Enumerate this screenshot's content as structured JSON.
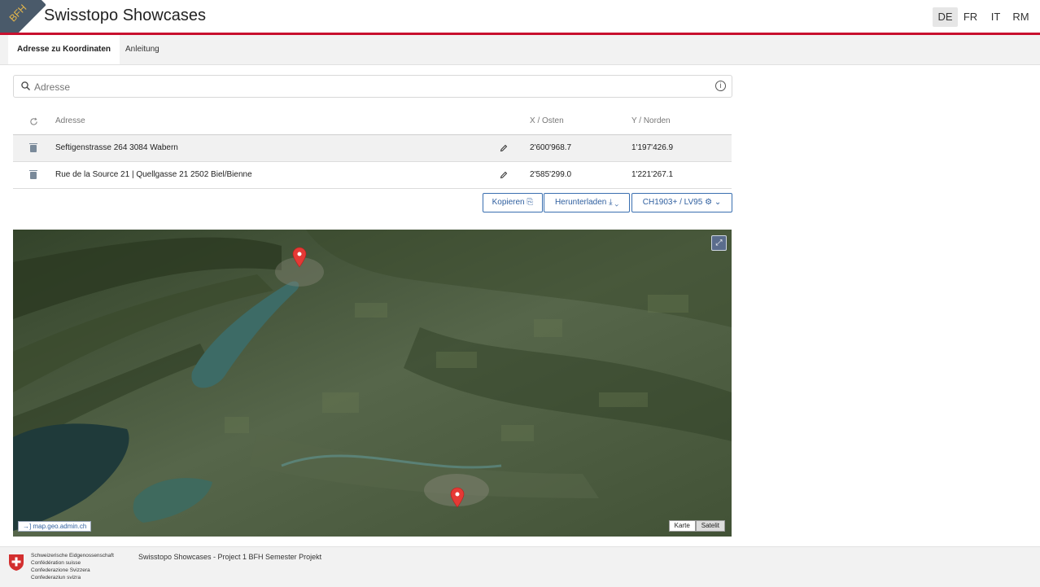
{
  "header": {
    "logo_text": "BFH",
    "title": "Swisstopo Showcases",
    "languages": [
      "DE",
      "FR",
      "IT",
      "RM"
    ],
    "active_language": "DE"
  },
  "tabs": [
    {
      "label": "Adresse zu Koordinaten",
      "active": true
    },
    {
      "label": "Anleitung",
      "active": false
    }
  ],
  "search": {
    "placeholder": "Adresse",
    "value": ""
  },
  "table": {
    "headers": {
      "address": "Adresse",
      "x": "X / Osten",
      "y": "Y / Norden"
    },
    "rows": [
      {
        "address": "Seftigenstrasse 264 3084 Wabern",
        "x": "2'600'968.7",
        "y": "1'197'426.9",
        "selected": true
      },
      {
        "address": "Rue de la Source 21 | Quellgasse 21 2502 Biel/Bienne",
        "x": "2'585'299.0",
        "y": "1'221'267.1",
        "selected": false
      }
    ]
  },
  "actions": {
    "copy": "Kopieren",
    "download": "Herunterladen",
    "crs": "CH1903+ / LV95"
  },
  "map": {
    "external_link": "map.geo.admin.ch",
    "layers": [
      "Karte",
      "Satelit"
    ],
    "active_layer": "Satelit"
  },
  "footer": {
    "federation": [
      "Schweizerische Eidgenossenschaft",
      "Confédération suisse",
      "Confederazione Svizzera",
      "Confederaziun svizra"
    ],
    "text": "Swisstopo Showcases - Project 1 BFH Semester Projekt"
  },
  "colors": {
    "accent_red": "#c8102e",
    "link_blue": "#2f5f9f",
    "marker_red": "#e53935"
  }
}
